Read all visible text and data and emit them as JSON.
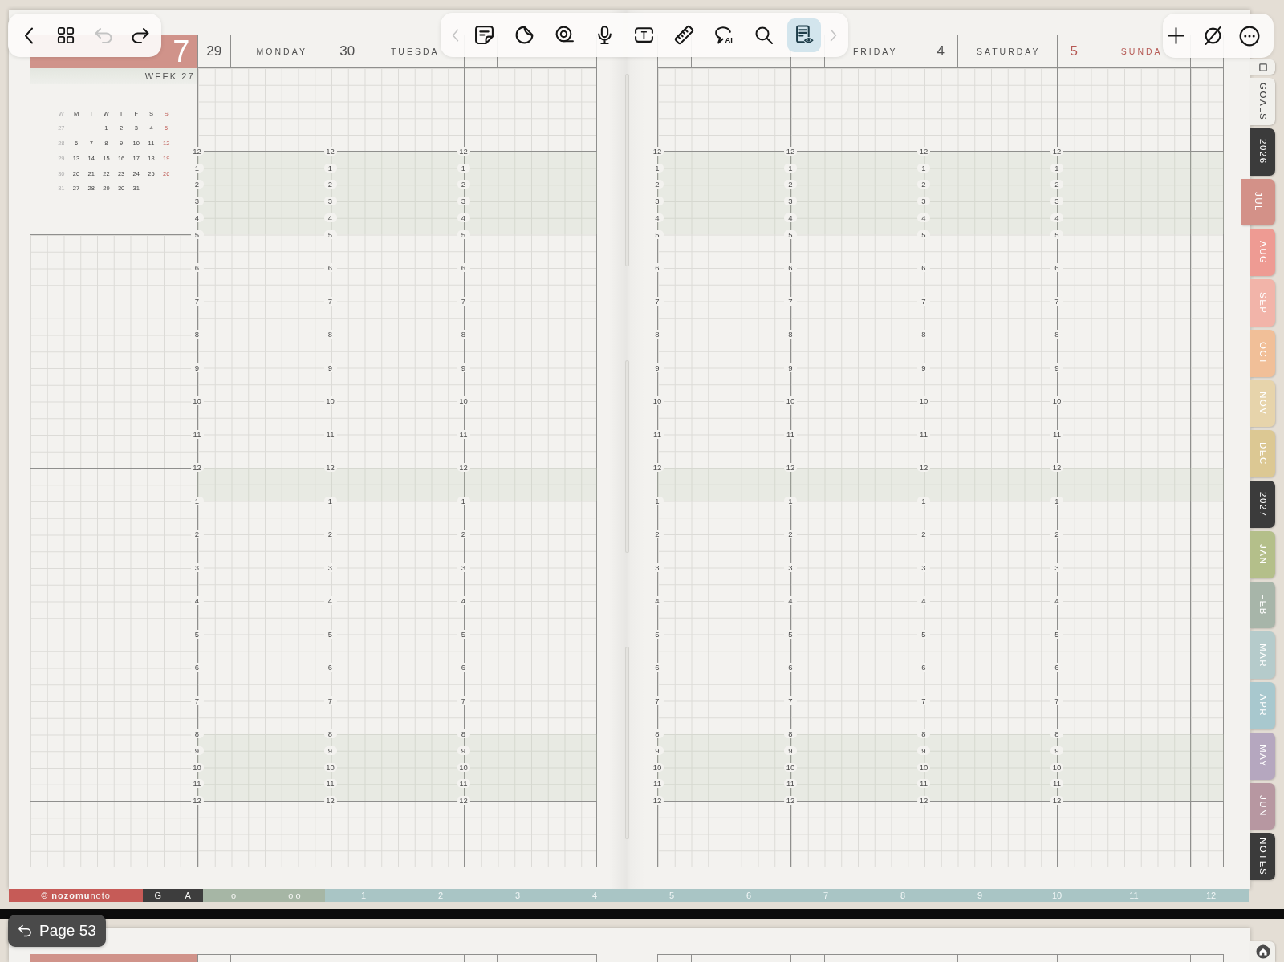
{
  "left_toolbar": [
    {
      "kind": "back",
      "disabled": false
    },
    {
      "kind": "pages",
      "disabled": false
    },
    {
      "kind": "undo",
      "disabled": true
    },
    {
      "kind": "redo",
      "disabled": false
    }
  ],
  "center_toolbar": {
    "previous": {
      "disabled": true
    },
    "tools": [
      {
        "kind": "sticky-note",
        "selected": false
      },
      {
        "kind": "sticker",
        "selected": false
      },
      {
        "kind": "tape",
        "selected": false
      },
      {
        "kind": "microphone",
        "selected": false
      },
      {
        "kind": "text-box",
        "glyph": "T",
        "selected": false
      },
      {
        "kind": "ruler",
        "selected": false
      },
      {
        "kind": "ai-lasso",
        "glyph": "AI",
        "selected": false
      },
      {
        "kind": "search",
        "selected": false
      },
      {
        "kind": "reading-mode",
        "selected": true
      }
    ],
    "next": {
      "disabled": true
    }
  },
  "right_toolbar": [
    {
      "kind": "add"
    },
    {
      "kind": "clear"
    },
    {
      "kind": "more"
    }
  ],
  "left_page": {
    "week_header": {
      "month_number": "7",
      "week_label": "WEEK 27"
    },
    "mini_calendar": {
      "headers": [
        "W",
        "M",
        "T",
        "W",
        "T",
        "F",
        "S",
        "S"
      ],
      "weeks": [
        {
          "week": "27",
          "right_aligned": true,
          "days": [
            "1",
            "2",
            "3",
            "4",
            "5"
          ]
        },
        {
          "week": "28",
          "days": [
            "6",
            "7",
            "8",
            "9",
            "10",
            "11",
            "12"
          ]
        },
        {
          "week": "29",
          "days": [
            "13",
            "14",
            "15",
            "16",
            "17",
            "18",
            "19"
          ]
        },
        {
          "week": "30",
          "days": [
            "20",
            "21",
            "22",
            "23",
            "24",
            "25",
            "26"
          ]
        },
        {
          "week": "31",
          "right_aligned": false,
          "days": [
            "27",
            "28",
            "29",
            "30",
            "31"
          ]
        }
      ]
    },
    "days": [
      {
        "date": "29",
        "name": "MONDAY",
        "accent": false,
        "hours": [
          "12",
          "1",
          "2",
          "3",
          "4",
          "5",
          "6",
          "7",
          "8",
          "9",
          "10",
          "11",
          "12",
          "1",
          "2",
          "3",
          "4",
          "5",
          "6",
          "7",
          "8",
          "9",
          "10",
          "11",
          "12"
        ]
      },
      {
        "date": "30",
        "name": "TUESDA",
        "accent": false,
        "hours": [
          "12",
          "1",
          "2",
          "3",
          "4",
          "5",
          "6",
          "7",
          "8",
          "9",
          "10",
          "11",
          "12",
          "1",
          "2",
          "3",
          "4",
          "5",
          "6",
          "7",
          "8",
          "9",
          "10",
          "11",
          "12"
        ]
      },
      {
        "hours": [
          "12",
          "1",
          "2",
          "3",
          "4",
          "5",
          "6",
          "7",
          "8",
          "9",
          "10",
          "11",
          "12",
          "1",
          "2",
          "3",
          "4",
          "5",
          "6",
          "7",
          "8",
          "9",
          "10",
          "11",
          "12"
        ]
      }
    ]
  },
  "right_page": {
    "days": [
      {
        "hours": [
          "12",
          "1",
          "2",
          "3",
          "4",
          "5",
          "6",
          "7",
          "8",
          "9",
          "10",
          "11",
          "12",
          "1",
          "2",
          "3",
          "4",
          "5",
          "6",
          "7",
          "8",
          "9",
          "10",
          "11",
          "12"
        ]
      },
      {
        "name": "FRIDAY",
        "accent": false,
        "hours": [
          "12",
          "1",
          "2",
          "3",
          "4",
          "5",
          "6",
          "7",
          "8",
          "9",
          "10",
          "11",
          "12",
          "1",
          "2",
          "3",
          "4",
          "5",
          "6",
          "7",
          "8",
          "9",
          "10",
          "11",
          "12"
        ]
      },
      {
        "date": "4",
        "name": "SATURDAY",
        "accent": false,
        "hours": [
          "12",
          "1",
          "2",
          "3",
          "4",
          "5",
          "6",
          "7",
          "8",
          "9",
          "10",
          "11",
          "12",
          "1",
          "2",
          "3",
          "4",
          "5",
          "6",
          "7",
          "8",
          "9",
          "10",
          "11",
          "12"
        ]
      },
      {
        "date": "5",
        "name": "SUNDA",
        "accent": true,
        "hours": [
          "12",
          "1",
          "2",
          "3",
          "4",
          "5",
          "6",
          "7",
          "8",
          "9",
          "10",
          "11",
          "12",
          "1",
          "2",
          "3",
          "4",
          "5",
          "6",
          "7",
          "8",
          "9",
          "10",
          "11",
          "12"
        ]
      }
    ]
  },
  "side_tabs": [
    {
      "label": "GOALS",
      "color": "#f1f0ec",
      "selected": false
    },
    {
      "label": "2026",
      "color": "#3b3b3b",
      "selected": false
    },
    {
      "label": "JUL",
      "color": "#d39188",
      "selected": true
    },
    {
      "label": "AUG",
      "color": "#ee9b93",
      "selected": false
    },
    {
      "label": "SEP",
      "color": "#f2b4a9",
      "selected": false
    },
    {
      "label": "OCT",
      "color": "#f1bf98",
      "selected": false
    },
    {
      "label": "NOV",
      "color": "#e7d4ab",
      "selected": false
    },
    {
      "label": "DEC",
      "color": "#dcc893",
      "selected": false
    },
    {
      "label": "2027",
      "color": "#3b3b3b",
      "selected": false
    },
    {
      "label": "JAN",
      "color": "#b4bf8a",
      "selected": false
    },
    {
      "label": "FEB",
      "color": "#a7b5a9",
      "selected": false
    },
    {
      "label": "MAR",
      "color": "#b5cbcb",
      "selected": false
    },
    {
      "label": "APR",
      "color": "#a8c8ce",
      "selected": false
    },
    {
      "label": "MAY",
      "color": "#b5a7bf",
      "selected": false
    },
    {
      "label": "JUN",
      "color": "#b797a1",
      "selected": false
    },
    {
      "label": "NOTES",
      "color": "#3b3b3b",
      "selected": false
    }
  ],
  "bottom_tabs": [
    {
      "symbol": "©",
      "label": "**nozomu**noto",
      "kind": "brand",
      "color": "#c65b57"
    },
    {
      "label": "G",
      "kind": "letter",
      "color": "#3d3d3d"
    },
    {
      "label": "A",
      "kind": "letter",
      "color": "#3d3d3d"
    },
    {
      "label": "o",
      "kind": "symbol",
      "color": "#a6b6a5"
    },
    {
      "label": "o o",
      "kind": "symbol",
      "color": "#a6b6a5"
    },
    {
      "label": "1",
      "kind": "number",
      "color": "#a9c5c5"
    },
    {
      "label": "2",
      "kind": "number",
      "color": "#a9c5c5"
    },
    {
      "label": "3",
      "kind": "number",
      "color": "#a9c5c5"
    },
    {
      "label": "4",
      "kind": "number",
      "color": "#a9c5c5"
    },
    {
      "label": "5",
      "kind": "number",
      "color": "#a9c5c5"
    },
    {
      "label": "6",
      "kind": "number",
      "color": "#a9c5c5"
    },
    {
      "label": "7",
      "kind": "number",
      "color": "#a9c5c5"
    },
    {
      "label": "8",
      "kind": "number",
      "color": "#a9c5c5"
    },
    {
      "label": "9",
      "kind": "number",
      "color": "#a9c5c5"
    },
    {
      "label": "10",
      "kind": "number",
      "color": "#a9c5c5"
    },
    {
      "label": "11",
      "kind": "number",
      "color": "#a9c5c5"
    },
    {
      "label": "12",
      "kind": "number",
      "color": "#a9c5c5"
    }
  ],
  "page_indicator": {
    "label": "Page 53"
  }
}
